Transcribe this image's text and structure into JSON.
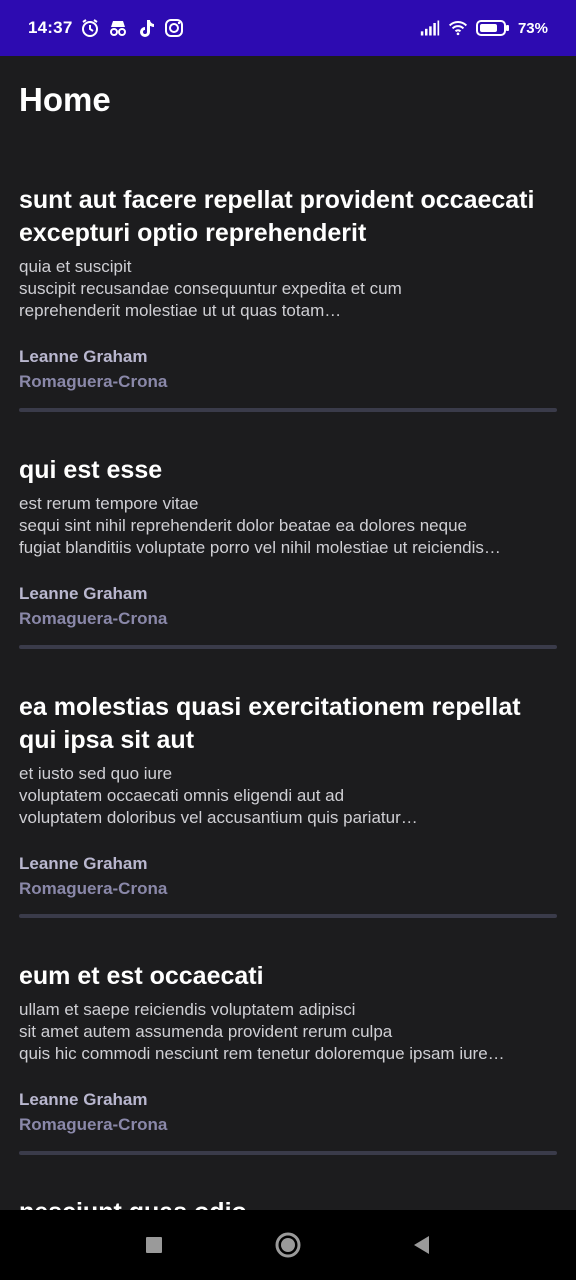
{
  "status_bar": {
    "time": "14:37",
    "battery": "73%",
    "icons": [
      "alarm-icon",
      "incognito-icon",
      "tiktok-icon",
      "instagram-icon",
      "signal-icon",
      "wifi-icon",
      "battery-icon"
    ],
    "background": "#2d0bb1"
  },
  "app": {
    "title": "Home"
  },
  "posts": [
    {
      "title": "sunt aut facere repellat provident occaecati excepturi optio reprehenderit",
      "body_lines": [
        "quia et suscipit",
        "suscipit recusandae consequuntur expedita et cum",
        "reprehenderit molestiae ut ut quas totam…"
      ],
      "author": "Leanne Graham",
      "company": "Romaguera-Crona"
    },
    {
      "title": "qui est esse",
      "body_lines": [
        "est rerum tempore vitae",
        "sequi sint nihil reprehenderit dolor beatae ea dolores neque",
        "fugiat blanditiis voluptate porro vel nihil molestiae ut reiciendis…"
      ],
      "author": "Leanne Graham",
      "company": "Romaguera-Crona"
    },
    {
      "title": "ea molestias quasi exercitationem repellat qui ipsa sit aut",
      "body_lines": [
        "et iusto sed quo iure",
        "voluptatem occaecati omnis eligendi aut ad",
        "voluptatem doloribus vel accusantium quis pariatur…"
      ],
      "author": "Leanne Graham",
      "company": "Romaguera-Crona"
    },
    {
      "title": "eum et est occaecati",
      "body_lines": [
        "ullam et saepe reiciendis voluptatem adipisci",
        "sit amet autem assumenda provident rerum culpa",
        "quis hic commodi nesciunt rem tenetur doloremque ipsam iure…"
      ],
      "author": "Leanne Graham",
      "company": "Romaguera-Crona"
    },
    {
      "title": "nesciunt quas odio",
      "body_lines": [],
      "author": "",
      "company": ""
    }
  ],
  "nav": {
    "buttons": [
      "recents-button",
      "home-button",
      "back-button"
    ]
  }
}
